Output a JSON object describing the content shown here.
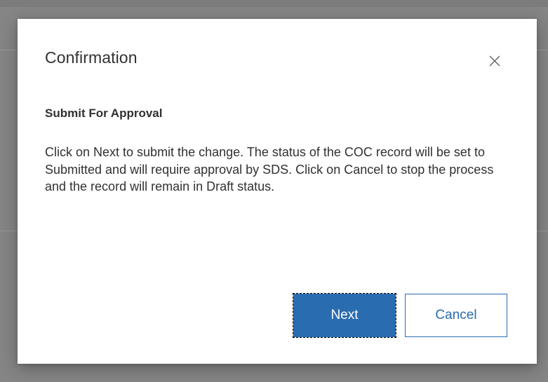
{
  "dialog": {
    "title": "Confirmation",
    "close_icon": "close-icon",
    "subtitle": "Submit For Approval",
    "message": "Click on Next to submit the change. The status of the COC record will be set to Submitted and will require approval by SDS. Click on Cancel to stop the process and the record will remain in Draft status.",
    "next_label": "Next",
    "cancel_label": "Cancel"
  },
  "colors": {
    "primary": "#2a6cb0",
    "overlay": "#858585",
    "text": "#323130"
  }
}
